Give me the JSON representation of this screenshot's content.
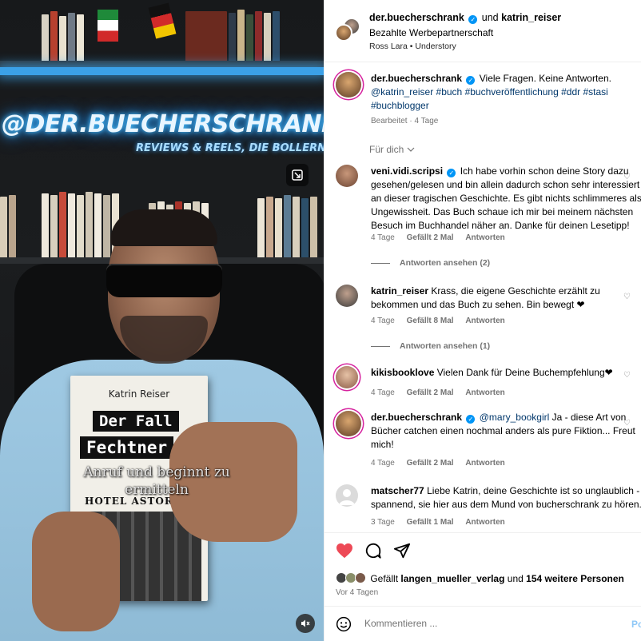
{
  "media": {
    "neon_text": "@DER.BUECHERSCHRANK",
    "neon_sub": "REVIEWS & REELS, DIE BOLLERN",
    "book": {
      "author": "Katrin Reiser",
      "title_line1": "Der Fall",
      "title_line2": "Fechtner",
      "hotel": "HOTEL ASTORIA"
    },
    "caption_line1": "Anruf und beginnt zu",
    "caption_line2": "ermitteln",
    "expand_icon": "expand-icon",
    "mute_icon": "mute-icon"
  },
  "header": {
    "user1": "der.buecherschrank",
    "and": "und",
    "user2": "katrin_reiser",
    "paid": "Bezahlte Werbepartnerschaft",
    "audio_artist": "Ross Lara",
    "audio_sep": "•",
    "audio_track": "Understory"
  },
  "caption": {
    "user": "der.buecherschrank",
    "text": "Viele Fragen. Keine Antworten.",
    "tags": "@katrin_reiser #buch #buchveröffentlichung #ddr #stasi #buchblogger",
    "meta": "Bearbeitet · 4 Tage"
  },
  "for_you": "Für dich",
  "comments": [
    {
      "user": "veni.vidi.scripsi",
      "text": "Ich habe vorhin schon deine Story dazu gesehen/gelesen und bin allein dadurch schon sehr interessiert an dieser tragischen Geschichte. Es gibt nichts schlimmeres als Ungewissheit. Das Buch schaue ich mir bei meinem nächsten Besuch im Buchhandel näher an. Danke für deinen Lesetipp!",
      "time": "4 Tage",
      "likes": "Gefällt 2 Mal",
      "reply": "Antworten",
      "replies": "Antworten ansehen (2)"
    },
    {
      "user": "katrin_reiser",
      "text": "Krass, die eigene Geschichte erzählt zu bekommen und das Buch zu sehen. Bin bewegt ❤",
      "time": "4 Tage",
      "likes": "Gefällt 8 Mal",
      "reply": "Antworten",
      "replies": "Antworten ansehen (1)"
    },
    {
      "user": "kikisbooklove",
      "text": "Vielen Dank für Deine Buchempfehlung❤",
      "time": "4 Tage",
      "likes": "Gefällt 2 Mal",
      "reply": "Antworten"
    },
    {
      "user": "der.buecherschrank",
      "mention": "@mary_bookgirl",
      "text": "Ja - diese Art von Bücher catchen einen nochmal anders als pure Fiktion... Freut mich!",
      "time": "4 Tage",
      "likes": "Gefällt 2 Mal",
      "reply": "Antworten"
    },
    {
      "user": "matscher77",
      "text": "Liebe Katrin, deine Geschichte ist so unglaublich - spannend, sie hier aus dem Mund von bucherschrank zu hören.",
      "time": "3 Tage",
      "likes": "Gefällt 1 Mal",
      "reply": "Antworten"
    }
  ],
  "likes_row": {
    "prefix": "Gefällt",
    "user": "langen_mueller_verlag",
    "and": "und",
    "others": "154 weitere Personen"
  },
  "date": "Vor 4 Tagen",
  "comment_bar": {
    "placeholder": "Kommentieren ...",
    "post": "Po"
  },
  "colors": {
    "accent": "#0095f6",
    "like_red": "#ed4956",
    "link": "#00376b",
    "meta_gray": "#737373"
  }
}
